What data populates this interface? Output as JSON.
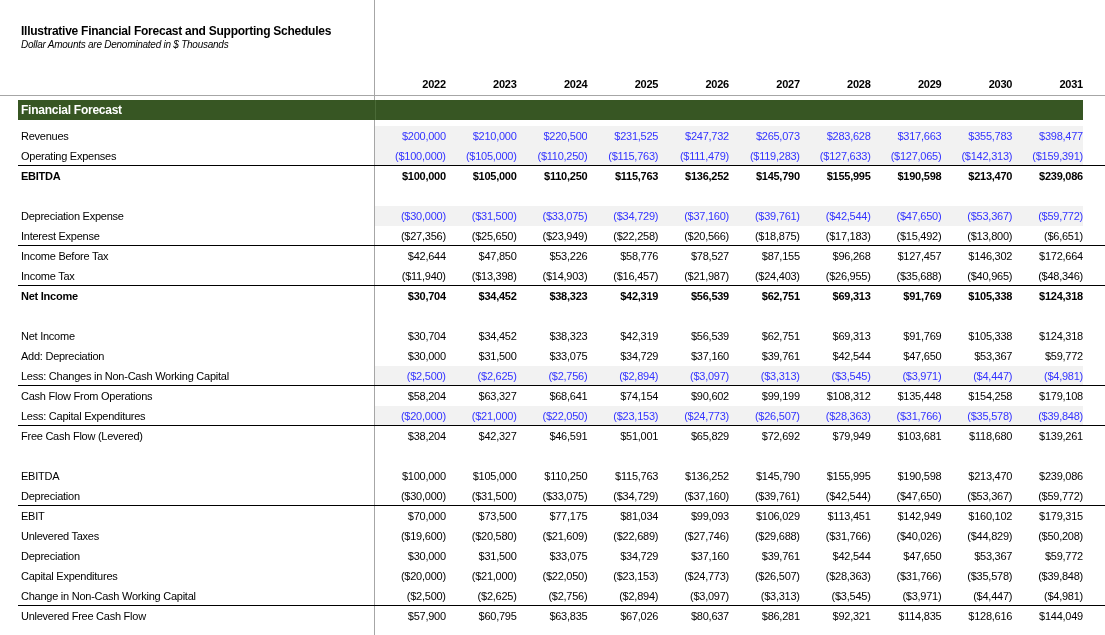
{
  "title": "Illustrative Financial Forecast and Supporting Schedules",
  "subtitle": "Dollar Amounts are Denominated in $ Thousands",
  "years": [
    "2022",
    "2023",
    "2024",
    "2025",
    "2026",
    "2027",
    "2028",
    "2029",
    "2030",
    "2031"
  ],
  "section": {
    "heading": "Financial Forecast"
  },
  "groups": [
    {
      "rows": [
        {
          "label": "Revenues",
          "kind": "input",
          "rule_below": false,
          "values": [
            "$200,000",
            "$210,000",
            "$220,500",
            "$231,525",
            "$247,732",
            "$265,073",
            "$283,628",
            "$317,663",
            "$355,783",
            "$398,477"
          ]
        },
        {
          "label": "Operating Expenses",
          "kind": "input",
          "rule_below": true,
          "values": [
            "($100,000)",
            "($105,000)",
            "($110,250)",
            "($115,763)",
            "($111,479)",
            "($119,283)",
            "($127,633)",
            "($127,065)",
            "($142,313)",
            "($159,391)"
          ]
        },
        {
          "label": "EBITDA",
          "kind": "total",
          "rule_below": false,
          "values": [
            "$100,000",
            "$105,000",
            "$110,250",
            "$115,763",
            "$136,252",
            "$145,790",
            "$155,995",
            "$190,598",
            "$213,470",
            "$239,086"
          ]
        }
      ]
    },
    {
      "rows": [
        {
          "label": "Depreciation Expense",
          "kind": "input",
          "rule_below": false,
          "values": [
            "($30,000)",
            "($31,500)",
            "($33,075)",
            "($34,729)",
            "($37,160)",
            "($39,761)",
            "($42,544)",
            "($47,650)",
            "($53,367)",
            "($59,772)"
          ]
        },
        {
          "label": "Interest Expense",
          "kind": "calc",
          "rule_below": true,
          "values": [
            "($27,356)",
            "($25,650)",
            "($23,949)",
            "($22,258)",
            "($20,566)",
            "($18,875)",
            "($17,183)",
            "($15,492)",
            "($13,800)",
            "($6,651)"
          ]
        },
        {
          "label": "Income Before Tax",
          "kind": "calc",
          "rule_below": false,
          "values": [
            "$42,644",
            "$47,850",
            "$53,226",
            "$58,776",
            "$78,527",
            "$87,155",
            "$96,268",
            "$127,457",
            "$146,302",
            "$172,664"
          ]
        },
        {
          "label": "Income Tax",
          "kind": "calc",
          "rule_below": true,
          "values": [
            "($11,940)",
            "($13,398)",
            "($14,903)",
            "($16,457)",
            "($21,987)",
            "($24,403)",
            "($26,955)",
            "($35,688)",
            "($40,965)",
            "($48,346)"
          ]
        },
        {
          "label": "Net Income",
          "kind": "total",
          "rule_below": false,
          "values": [
            "$30,704",
            "$34,452",
            "$38,323",
            "$42,319",
            "$56,539",
            "$62,751",
            "$69,313",
            "$91,769",
            "$105,338",
            "$124,318"
          ]
        }
      ]
    },
    {
      "rows": [
        {
          "label": "Net Income",
          "kind": "calc",
          "rule_below": false,
          "values": [
            "$30,704",
            "$34,452",
            "$38,323",
            "$42,319",
            "$56,539",
            "$62,751",
            "$69,313",
            "$91,769",
            "$105,338",
            "$124,318"
          ]
        },
        {
          "label": "Add: Depreciation",
          "kind": "calc",
          "rule_below": false,
          "values": [
            "$30,000",
            "$31,500",
            "$33,075",
            "$34,729",
            "$37,160",
            "$39,761",
            "$42,544",
            "$47,650",
            "$53,367",
            "$59,772"
          ]
        },
        {
          "label": "Less: Changes in Non-Cash Working Capital",
          "kind": "input",
          "rule_below": true,
          "values": [
            "($2,500)",
            "($2,625)",
            "($2,756)",
            "($2,894)",
            "($3,097)",
            "($3,313)",
            "($3,545)",
            "($3,971)",
            "($4,447)",
            "($4,981)"
          ]
        },
        {
          "label": "Cash Flow From Operations",
          "kind": "calc",
          "rule_below": false,
          "values": [
            "$58,204",
            "$63,327",
            "$68,641",
            "$74,154",
            "$90,602",
            "$99,199",
            "$108,312",
            "$135,448",
            "$154,258",
            "$179,108"
          ]
        },
        {
          "label": "Less: Capital Expenditures",
          "kind": "input",
          "rule_below": true,
          "values": [
            "($20,000)",
            "($21,000)",
            "($22,050)",
            "($23,153)",
            "($24,773)",
            "($26,507)",
            "($28,363)",
            "($31,766)",
            "($35,578)",
            "($39,848)"
          ]
        },
        {
          "label": "Free Cash Flow (Levered)",
          "kind": "calc",
          "rule_below": false,
          "values": [
            "$38,204",
            "$42,327",
            "$46,591",
            "$51,001",
            "$65,829",
            "$72,692",
            "$79,949",
            "$103,681",
            "$118,680",
            "$139,261"
          ]
        }
      ]
    },
    {
      "rows": [
        {
          "label": "EBITDA",
          "kind": "calc",
          "rule_below": false,
          "values": [
            "$100,000",
            "$105,000",
            "$110,250",
            "$115,763",
            "$136,252",
            "$145,790",
            "$155,995",
            "$190,598",
            "$213,470",
            "$239,086"
          ]
        },
        {
          "label": "Depreciation",
          "kind": "calc",
          "rule_below": true,
          "values": [
            "($30,000)",
            "($31,500)",
            "($33,075)",
            "($34,729)",
            "($37,160)",
            "($39,761)",
            "($42,544)",
            "($47,650)",
            "($53,367)",
            "($59,772)"
          ]
        },
        {
          "label": "EBIT",
          "kind": "calc",
          "rule_below": false,
          "values": [
            "$70,000",
            "$73,500",
            "$77,175",
            "$81,034",
            "$99,093",
            "$106,029",
            "$113,451",
            "$142,949",
            "$160,102",
            "$179,315"
          ]
        },
        {
          "label": "Unlevered Taxes",
          "kind": "calc",
          "rule_below": false,
          "values": [
            "($19,600)",
            "($20,580)",
            "($21,609)",
            "($22,689)",
            "($27,746)",
            "($29,688)",
            "($31,766)",
            "($40,026)",
            "($44,829)",
            "($50,208)"
          ]
        },
        {
          "label": "Depreciation",
          "kind": "calc",
          "rule_below": false,
          "values": [
            "$30,000",
            "$31,500",
            "$33,075",
            "$34,729",
            "$37,160",
            "$39,761",
            "$42,544",
            "$47,650",
            "$53,367",
            "$59,772"
          ]
        },
        {
          "label": "Capital Expenditures",
          "kind": "calc",
          "rule_below": false,
          "values": [
            "($20,000)",
            "($21,000)",
            "($22,050)",
            "($23,153)",
            "($24,773)",
            "($26,507)",
            "($28,363)",
            "($31,766)",
            "($35,578)",
            "($39,848)"
          ]
        },
        {
          "label": "Change in Non-Cash Working Capital",
          "kind": "calc",
          "rule_below": true,
          "values": [
            "($2,500)",
            "($2,625)",
            "($2,756)",
            "($2,894)",
            "($3,097)",
            "($3,313)",
            "($3,545)",
            "($3,971)",
            "($4,447)",
            "($4,981)"
          ]
        },
        {
          "label": "Unlevered Free Cash Flow",
          "kind": "calc",
          "rule_below": false,
          "values": [
            "$57,900",
            "$60,795",
            "$63,835",
            "$67,026",
            "$80,637",
            "$86,281",
            "$92,321",
            "$114,835",
            "$128,616",
            "$144,049"
          ]
        }
      ]
    }
  ]
}
